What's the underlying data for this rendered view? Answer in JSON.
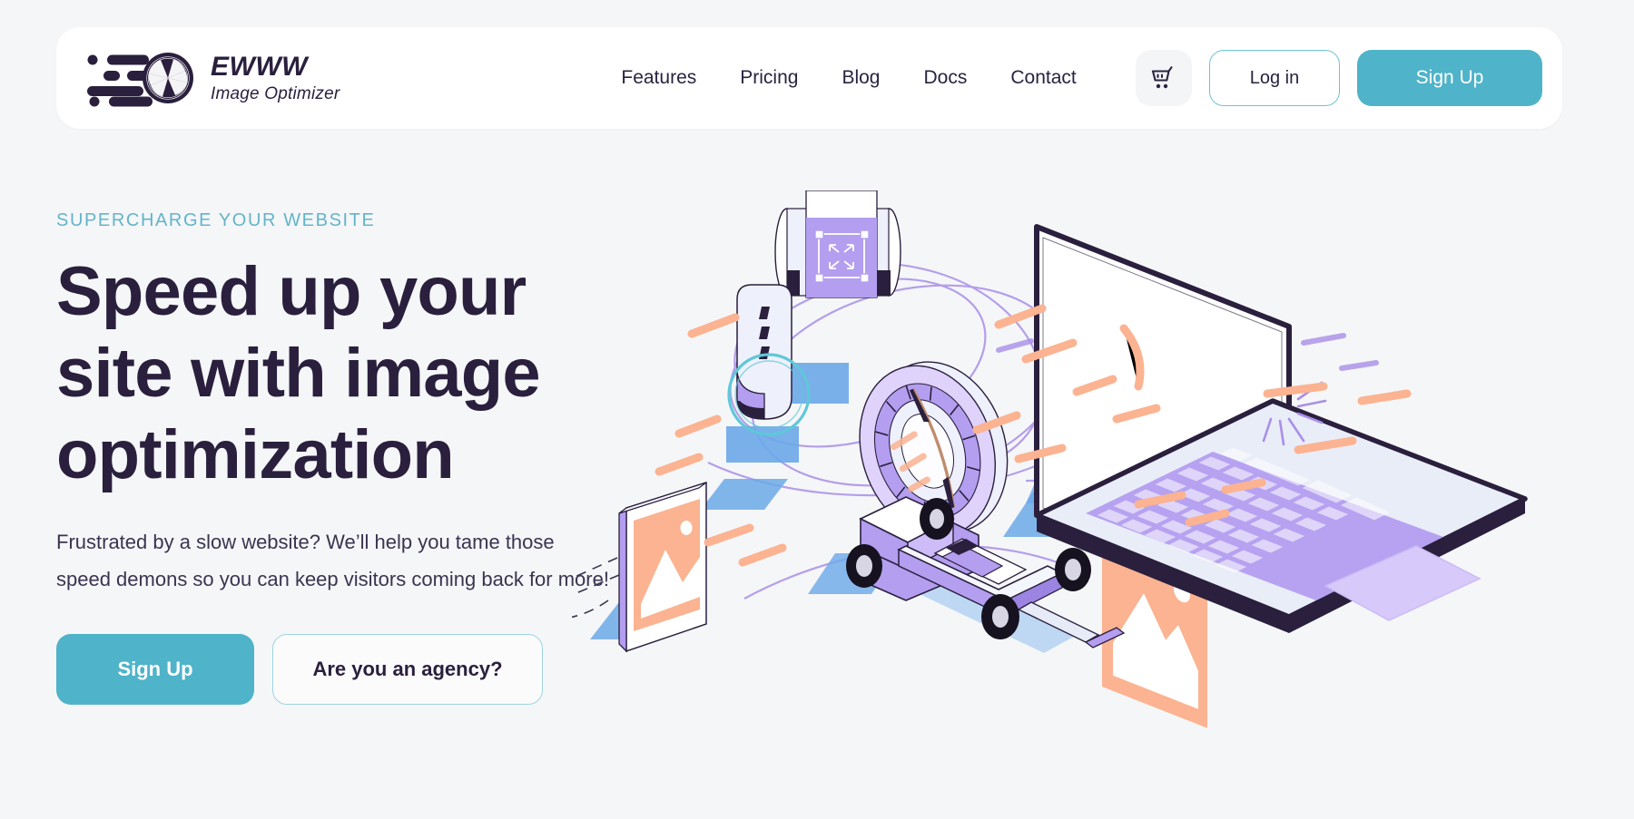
{
  "page": {
    "background_color": "#f5f6f8",
    "accent_color": "#4fb3c9",
    "heading_color": "#2a1f3d"
  },
  "header": {
    "brand": {
      "name": "EWWW",
      "subtitle": "Image Optimizer",
      "logo_icon": "camera-aperture-speed-icon"
    },
    "nav": [
      {
        "label": "Features"
      },
      {
        "label": "Pricing"
      },
      {
        "label": "Blog"
      },
      {
        "label": "Docs"
      },
      {
        "label": "Contact"
      }
    ],
    "actions": {
      "cart_icon": "shopping-cart-icon",
      "login_label": "Log in",
      "signup_label": "Sign Up"
    }
  },
  "hero": {
    "eyebrow": "SUPERCHARGE YOUR WEBSITE",
    "title": "Speed up your site with image optimization",
    "body": "Frustrated by a slow website? We’ll help you tame those speed demons so you can keep visitors coming back for more!",
    "primary_cta": "Sign Up",
    "secondary_cta": "Are you an agency?",
    "illustration": {
      "name": "isometric-image-optimization-illustration",
      "elements": [
        "laptop-with-image-placeholder",
        "formula-race-car",
        "speedometer-gauge",
        "film-canister-with-crop-handles",
        "floating-photo-card",
        "memory-card-device",
        "speed-trail-dashes"
      ],
      "colors": {
        "purple": "#b39ef0",
        "purple_light": "#d7c9fa",
        "peach": "#fbb391",
        "blue_shadow": "#6ba9e8",
        "outline": "#2a1f3d",
        "teal": "#5ec8d8"
      }
    }
  }
}
